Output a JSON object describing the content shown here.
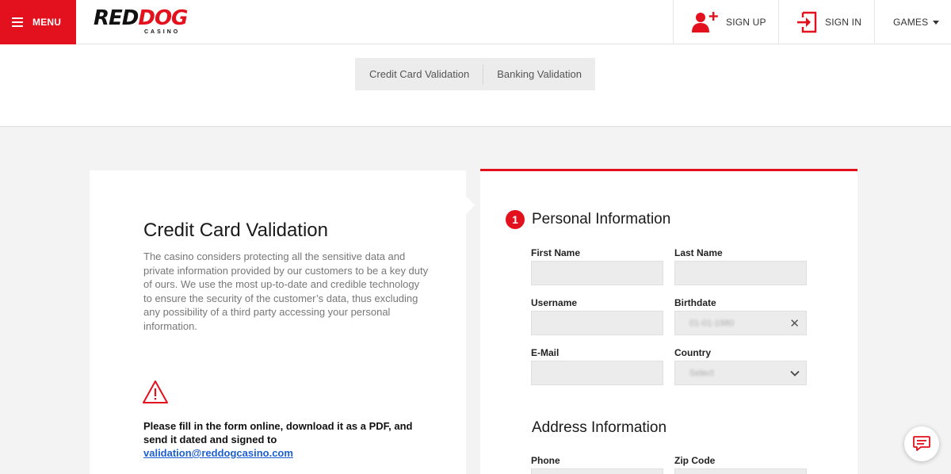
{
  "header": {
    "menu_label": "MENU",
    "logo": {
      "part1": "RED",
      "part2": "DOG",
      "sub": "CASINO"
    },
    "signup_label": "SIGN UP",
    "signin_label": "SIGN IN",
    "games_label": "GAMES"
  },
  "tabs": [
    {
      "label": "Credit Card Validation"
    },
    {
      "label": "Banking Validation"
    }
  ],
  "intro": {
    "title": "Credit Card Validation",
    "description": "The casino considers protecting all the sensitive data and private information provided by our customers to be a key duty of ours. We use the most up-to-date and credible technology to ensure the security of the customer’s data, thus excluding any possibility of a third party accessing your personal information.",
    "notice_text": "Please fill in the form online, download it as a PDF, and send it dated and signed to ",
    "notice_email": "validation@reddogcasino.com"
  },
  "form": {
    "step_number": "1",
    "personal_title": "Personal Information",
    "address_title": "Address Information",
    "fields": {
      "first_name": {
        "label": "First Name",
        "value": ""
      },
      "last_name": {
        "label": "Last Name",
        "value": ""
      },
      "username": {
        "label": "Username",
        "value": ""
      },
      "birthdate": {
        "label": "Birthdate",
        "value": "01-01-1980"
      },
      "email": {
        "label": "E-Mail",
        "value": ""
      },
      "country": {
        "label": "Country",
        "value": "Select"
      },
      "phone": {
        "label": "Phone",
        "value": ""
      },
      "zip": {
        "label": "Zip Code",
        "value": ""
      }
    }
  },
  "colors": {
    "brand_red": "#e3101d",
    "link_blue": "#1d5fd0"
  },
  "icons": [
    "menu-icon",
    "user-plus-icon",
    "sign-in-icon",
    "caret-down-icon",
    "warning-icon",
    "clear-icon",
    "chevron-down-icon",
    "chat-icon"
  ]
}
